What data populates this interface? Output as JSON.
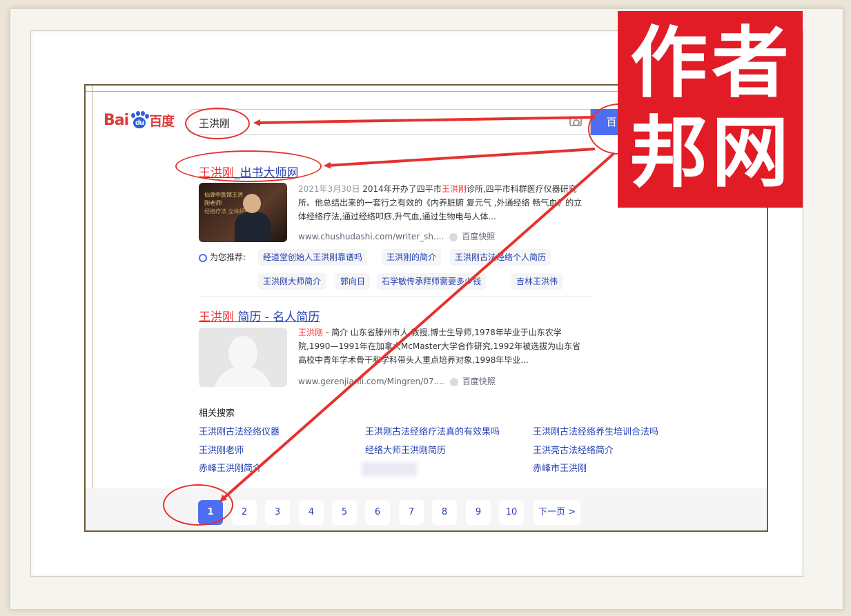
{
  "logo": {
    "bai": "Bai",
    "du": "du",
    "baidu": "百度"
  },
  "search": {
    "query": "王洪刚",
    "button_label": "百"
  },
  "results": [
    {
      "title_hl": "王洪刚",
      "title_rest": "_出书大师网",
      "date": "2021年3月30日",
      "snippet_pre": " 2014年开办了四平市",
      "snippet_hl": "王洪刚",
      "snippet_post": "诊所,四平市科群医疗仪器研究所。他总结出来的一套行之有效的《内养脏腑 复元气 ,外通经络 畅气血》的立体经络疗法,通过经络叩痧,升气血,通过生物电与人体...",
      "thumb_text": [
        "仙源中医馆王洪",
        "刚老师!",
        "经络疗法 立体经络"
      ],
      "source": "www.chushudashi.com/writer_sh....",
      "snapshot": "百度快照"
    },
    {
      "title_hl": "王洪刚",
      "title_rest": " 简历 - 名人简历",
      "snippet_hl": "王洪刚",
      "snippet_post": " - 简介 山东省滕州市人,教授,博士生导师,1978年毕业于山东农学院,1990—1991年在加拿大McMaster大学合作研究,1992年被选拔为山东省高校中青年学术骨干和学科带头人重点培养对象,1998年毕业...",
      "source": "www.gerenjianli.com/Mingren/07....",
      "snapshot": "百度快照"
    }
  ],
  "recommend": {
    "label": "为您推荐:",
    "tags": [
      "经道堂创始人王洪刚靠谱吗",
      "王洪刚的简介",
      "王洪刚古法经络个人简历",
      "王洪刚大师简介",
      "郭向日",
      "石学敏传承拜师需要多少钱",
      "吉林王洪伟"
    ]
  },
  "related": {
    "title": "相关搜索",
    "items": [
      "王洪刚古法经络仪器",
      "王洪刚古法经络疗法真的有效果吗",
      "王洪刚古法经络养生培训合法吗",
      "王洪刚老师",
      "经络大师王洪刚简历",
      "王洪亮古法经络简介",
      "赤峰王洪刚简介",
      "赤峰市王洪刚"
    ]
  },
  "pagination": {
    "pages": [
      "1",
      "2",
      "3",
      "4",
      "5",
      "6",
      "7",
      "8",
      "9",
      "10"
    ],
    "active": "1",
    "next_label": "下一页 >"
  },
  "stamp": {
    "chars": [
      "作",
      "者",
      "邦",
      "网"
    ],
    "color": "#e21c26"
  },
  "colors": {
    "link": "#2440b3",
    "highlight": "#f73131",
    "annotation": "#e5322d",
    "accent": "#4e6ef2"
  }
}
